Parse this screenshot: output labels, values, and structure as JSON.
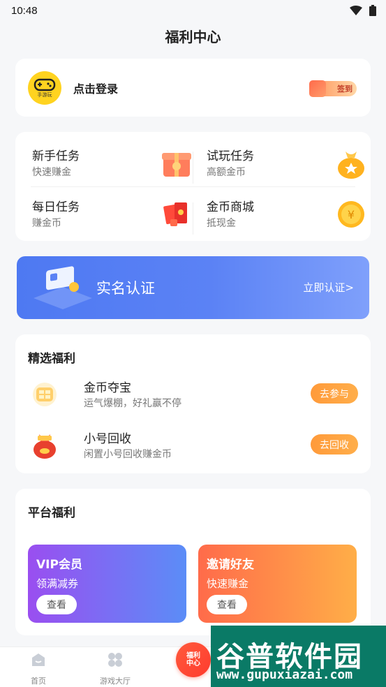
{
  "status_bar": {
    "time": "10:48"
  },
  "header": {
    "title": "福利中心"
  },
  "login": {
    "avatar_caption": "手游玩",
    "label": "点击登录",
    "sign_in_label": "签到"
  },
  "tasks": [
    {
      "title": "新手任务",
      "subtitle": "快速赚金"
    },
    {
      "title": "试玩任务",
      "subtitle": "高额金币"
    },
    {
      "title": "每日任务",
      "subtitle": "赚金币"
    },
    {
      "title": "金币商城",
      "subtitle": "抵现金"
    }
  ],
  "banner": {
    "title": "实名认证",
    "action": "立即认证>"
  },
  "featured": {
    "title": "精选福利",
    "items": [
      {
        "title": "金币夺宝",
        "subtitle": "运气爆棚，好礼赢不停",
        "button": "去参与"
      },
      {
        "title": "小号回收",
        "subtitle": "闲置小号回收赚金币",
        "button": "去回收"
      }
    ]
  },
  "platform": {
    "title": "平台福利",
    "cards": [
      {
        "title": "VIP会员",
        "subtitle": "领满减券",
        "button": "查看"
      },
      {
        "title": "邀请好友",
        "subtitle": "快速赚金",
        "button": "查看"
      }
    ]
  },
  "bottom_nav": {
    "items": [
      {
        "label": "首页"
      },
      {
        "label": "游戏大厅"
      }
    ],
    "center_label_line1": "福利",
    "center_label_line2": "中心"
  },
  "watermark": {
    "text": "谷普软件园",
    "url": "www.gupuxiazai.com"
  }
}
